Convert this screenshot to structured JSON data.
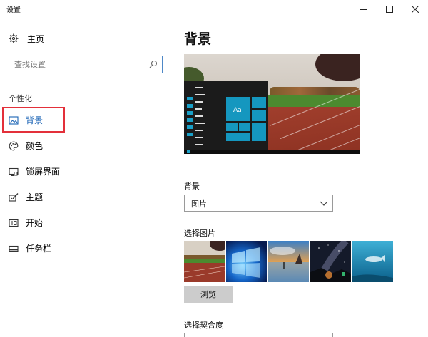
{
  "window": {
    "title": "设置"
  },
  "sidebar": {
    "home_label": "主页",
    "search_placeholder": "查找设置",
    "section_label": "个性化",
    "items": [
      {
        "label": "背景",
        "icon": "image-icon",
        "active": true
      },
      {
        "label": "颜色",
        "icon": "palette-icon",
        "active": false
      },
      {
        "label": "锁屏界面",
        "icon": "lock-screen-icon",
        "active": false
      },
      {
        "label": "主题",
        "icon": "theme-brush-icon",
        "active": false
      },
      {
        "label": "开始",
        "icon": "start-menu-icon",
        "active": false
      },
      {
        "label": "任务栏",
        "icon": "taskbar-icon",
        "active": false
      }
    ]
  },
  "main": {
    "title": "背景",
    "preview_tile_text": "Aa",
    "background_label": "背景",
    "background_value": "图片",
    "choose_picture_label": "选择图片",
    "browse_label": "浏览",
    "fit_label": "选择契合度"
  },
  "colors": {
    "accent": "#1a63b5",
    "tile": "#1597bf",
    "highlight_box": "#e3303a"
  }
}
